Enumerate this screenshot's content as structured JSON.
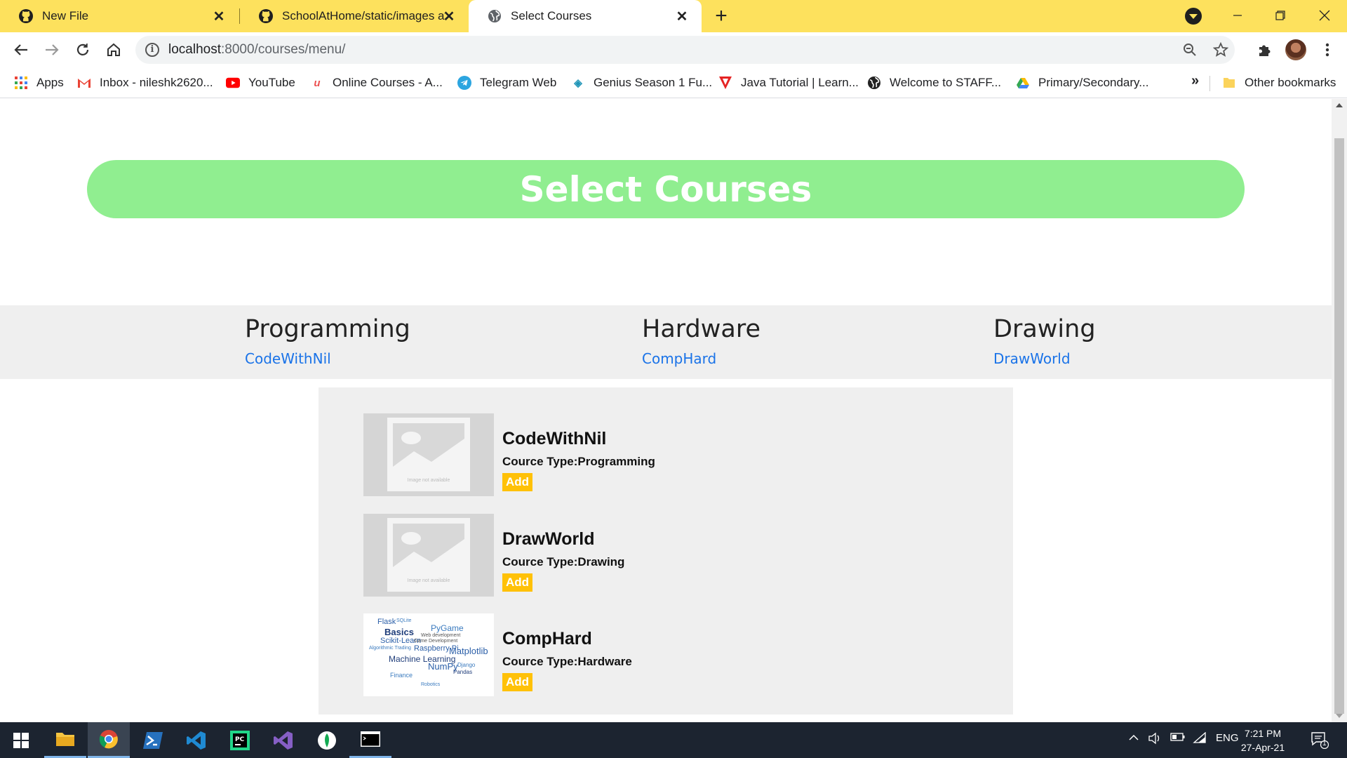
{
  "browser": {
    "tabs": [
      {
        "title": "New File",
        "icon": "github-icon",
        "active": false
      },
      {
        "title": "SchoolAtHome/static/images at",
        "icon": "github-icon",
        "active": false
      },
      {
        "title": "Select Courses",
        "icon": "globe-icon",
        "active": true
      }
    ],
    "url_host": "localhost",
    "url_path": ":8000/courses/menu/",
    "bookmarks": [
      {
        "label": "Apps",
        "icon": "apps-grid-icon"
      },
      {
        "label": "Inbox - nileshk2620...",
        "icon": "gmail-icon"
      },
      {
        "label": "YouTube",
        "icon": "youtube-icon"
      },
      {
        "label": "Online Courses - A...",
        "icon": "udemy-icon"
      },
      {
        "label": "Telegram Web",
        "icon": "telegram-icon"
      },
      {
        "label": "Genius Season 1 Fu...",
        "icon": "genius-icon"
      },
      {
        "label": "Java Tutorial | Learn...",
        "icon": "java-tutorial-icon"
      },
      {
        "label": "Welcome to STAFF...",
        "icon": "globe-icon"
      },
      {
        "label": "Primary/Secondary...",
        "icon": "drive-icon"
      }
    ],
    "more_bookmarks": "»",
    "other_bookmarks": "Other bookmarks"
  },
  "page": {
    "heading": "Select Courses",
    "categories": [
      {
        "title": "Programming",
        "link": "CodeWithNil"
      },
      {
        "title": "Hardware",
        "link": "CompHard"
      },
      {
        "title": "Drawing",
        "link": "DrawWorld"
      }
    ],
    "courses": [
      {
        "name": "CodeWithNil",
        "type_label": "Cource Type:Programming",
        "add_label": "Add",
        "image": "placeholder",
        "image_note": "Image not available"
      },
      {
        "name": "DrawWorld",
        "type_label": "Cource Type:Drawing",
        "add_label": "Add",
        "image": "placeholder",
        "image_note": "Image not available"
      },
      {
        "name": "CompHard",
        "type_label": "Cource Type:Hardware",
        "add_label": "Add",
        "image": "wordcloud",
        "wordcloud": [
          "Flask",
          "SQLite",
          "PyGame",
          "Basics",
          "Web development",
          "Scikit-Learn",
          "Game Development",
          "Algorithmic Trading",
          "Raspberry Pi",
          "Matplotlib",
          "Machine Learning",
          "NumPy",
          "Django",
          "Pandas",
          "Finance",
          "Robotics"
        ]
      }
    ]
  },
  "taskbar": {
    "apps": [
      "file-explorer-icon",
      "chrome-icon",
      "powershell-icon",
      "vscode-icon",
      "pycharm-icon",
      "visual-studio-icon",
      "mongodb-compass-icon",
      "terminal-icon"
    ],
    "language": "ENG",
    "time": "7:21 PM",
    "date": "27-Apr-21",
    "notification_count": "1"
  },
  "colors": {
    "tabstrip": "#fde15d",
    "banner": "#90ee90",
    "add_button": "#ffc107",
    "link": "#1a73e8",
    "category_band": "#efefef",
    "taskbar": "#1c2430"
  }
}
